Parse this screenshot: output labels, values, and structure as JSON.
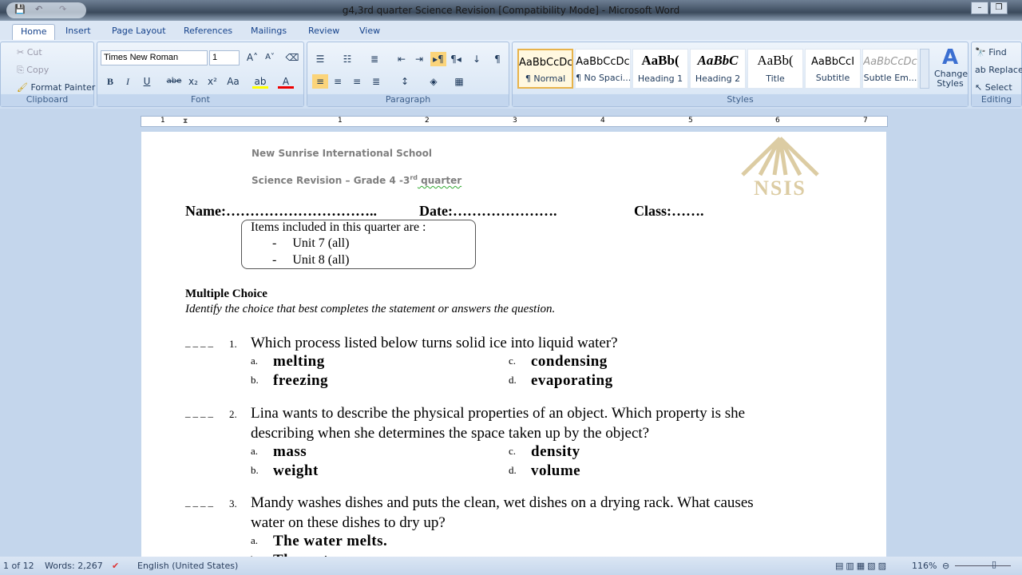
{
  "window": {
    "title": "g4,3rd quarter Science Revision [Compatibility Mode] - Microsoft Word"
  },
  "tabs": [
    "Home",
    "Insert",
    "Page Layout",
    "References",
    "Mailings",
    "Review",
    "View"
  ],
  "clipboard": {
    "cut": "Cut",
    "copy": "Copy",
    "format_painter": "Format Painter",
    "label": "Clipboard"
  },
  "font": {
    "name": "Times New Roman",
    "size": "1",
    "label": "Font"
  },
  "paragraph": {
    "label": "Paragraph"
  },
  "styles": {
    "label": "Styles",
    "items": [
      {
        "preview": "AaBbCcDc",
        "name": "¶ Normal"
      },
      {
        "preview": "AaBbCcDc",
        "name": "¶ No Spaci..."
      },
      {
        "preview": "AaBb(",
        "name": "Heading 1"
      },
      {
        "preview": "AaBbC",
        "name": "Heading 2"
      },
      {
        "preview": "AaBb(",
        "name": "Title"
      },
      {
        "preview": "AaBbCcI",
        "name": "Subtitle"
      },
      {
        "preview": "AaBbCcDc",
        "name": "Subtle Em..."
      }
    ],
    "change_styles": "Change Styles"
  },
  "editing": {
    "find": "Find",
    "replace": "Replace",
    "select": "Select",
    "label": "Editing"
  },
  "ruler": [
    "1",
    "1",
    "2",
    "3",
    "4",
    "5",
    "6",
    "7"
  ],
  "doc": {
    "school": "New Sunrise International  School",
    "subtitle_pre": "Science Revision – Grade 4 -3",
    "subtitle_sup": "rd",
    "subtitle_post": " quarter",
    "logo_text": "NSIS",
    "name": "Name:…………………………..",
    "date": "Date:………………….",
    "class": "Class:…….",
    "items_title": "Items included in this quarter are :",
    "items": [
      "Unit 7 (all)",
      "Unit 8 (all)"
    ],
    "section": "Multiple Choice",
    "instructions": "Identify the choice that best completes the statement or answers the question.",
    "questions": [
      {
        "num": "1.",
        "blank": "____",
        "text": [
          "Which process listed below turns solid ice into liquid water?"
        ],
        "choices": [
          [
            "a.",
            "melting"
          ],
          [
            "b.",
            "freezing"
          ],
          [
            "c.",
            "condensing"
          ],
          [
            "d.",
            "evaporating"
          ]
        ]
      },
      {
        "num": "2.",
        "blank": "____",
        "text": [
          "Lina wants to describe the physical properties of an object. Which property is she",
          "describing when she determines the space taken up by the object?"
        ],
        "choices": [
          [
            "a.",
            "mass"
          ],
          [
            "b.",
            "weight"
          ],
          [
            "c.",
            "density"
          ],
          [
            "d.",
            "volume"
          ]
        ]
      },
      {
        "num": "3.",
        "blank": "____",
        "text": [
          "Mandy washes dishes and puts the clean, wet dishes on a drying rack. What causes",
          "water on these dishes to dry up?"
        ],
        "choices": [
          [
            "a.",
            "The water melts."
          ],
          [
            "b.",
            "The water"
          ]
        ]
      }
    ]
  },
  "status": {
    "page": "1 of 12",
    "words": "Words: 2,267",
    "language": "English (United States)",
    "zoom": "116%"
  }
}
